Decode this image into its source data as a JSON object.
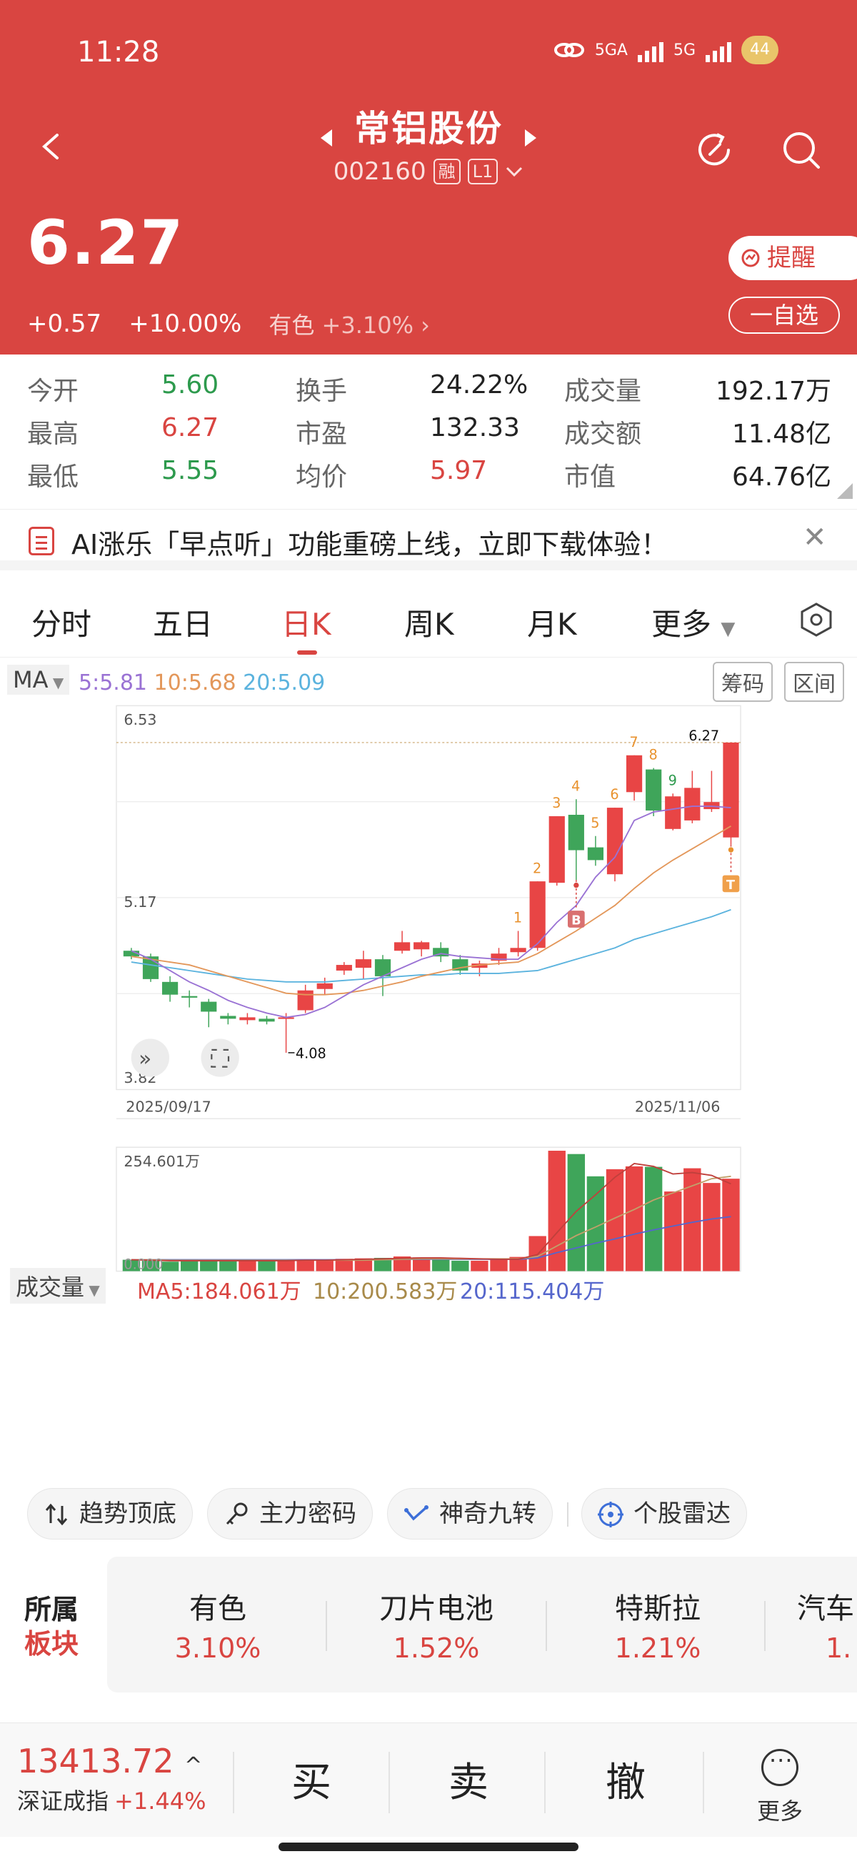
{
  "status_bar": {
    "time": "11:28",
    "net1": "5GA",
    "net2": "5G",
    "battery": "44"
  },
  "header": {
    "stock_name": "常铝股份",
    "stock_code": "002160",
    "tag_margin": "融",
    "tag_level": "L1",
    "price": "6.27",
    "change": "+0.57",
    "change_pct": "+10.00%",
    "sector_name": "有色",
    "sector_pct": "+3.10%",
    "remind_label": "提醒",
    "fav_label": "一自选"
  },
  "quote": {
    "open_label": "今开",
    "open": "5.60",
    "high_label": "最高",
    "high": "6.27",
    "low_label": "最低",
    "low": "5.55",
    "turnover_label": "换手",
    "turnover": "24.22%",
    "pe_label": "市盈",
    "pe": "132.33",
    "avg_label": "均价",
    "avg": "5.97",
    "volume_label": "成交量",
    "volume": "192.17万",
    "amount_label": "成交额",
    "amount": "11.48亿",
    "mktcap_label": "市值",
    "mktcap": "64.76亿"
  },
  "notice": {
    "text": "AI涨乐「早点听」功能重磅上线，立即下载体验！"
  },
  "tabs": [
    "分时",
    "五日",
    "日K",
    "周K",
    "月K",
    "更多"
  ],
  "ma": {
    "selector": "MA",
    "ma5": "5:5.81",
    "ma10": "10:5.68",
    "ma20": "20:5.09",
    "chip_label": "筹码",
    "range_label": "区间"
  },
  "volume_header": {
    "selector": "成交量",
    "ma5": "MA5:184.061万",
    "ma10": "10:200.583万",
    "ma20": "20:115.404万"
  },
  "tools": [
    "趋势顶底",
    "主力密码",
    "神奇九转",
    "个股雷达"
  ],
  "sectors": {
    "title1": "所属",
    "title2": "板块",
    "items": [
      {
        "name": "有色",
        "pct": "3.10%"
      },
      {
        "name": "刀片电池",
        "pct": "1.52%"
      },
      {
        "name": "特斯拉",
        "pct": "1.21%"
      },
      {
        "name": "汽车",
        "pct": "1."
      }
    ]
  },
  "bottom": {
    "index_value": "13413.72",
    "index_name": "深证成指",
    "index_pct": "+1.44%",
    "buy": "买",
    "sell": "卖",
    "cancel": "撤",
    "more": "更多"
  },
  "colors": {
    "up": "#e84545",
    "down": "#3fa55a",
    "brand": "#d94541",
    "ma5": "#9a72d4",
    "ma10": "#e3975a",
    "ma20": "#5bb3de"
  },
  "chart_data": {
    "type": "candlestick",
    "x_start": "2025/09/17",
    "x_end": "2025/11/06",
    "y_labels": [
      "6.53",
      "5.17",
      "3.82"
    ],
    "ylim": [
      3.82,
      6.53
    ],
    "max_label": "6.27",
    "min_label": "4.08",
    "candles": [
      {
        "o": 4.8,
        "c": 4.76,
        "h": 4.82,
        "l": 4.74
      },
      {
        "o": 4.76,
        "c": 4.6,
        "h": 4.78,
        "l": 4.58
      },
      {
        "o": 4.58,
        "c": 4.49,
        "h": 4.62,
        "l": 4.44
      },
      {
        "o": 4.48,
        "c": 4.47,
        "h": 4.52,
        "l": 4.4
      },
      {
        "o": 4.44,
        "c": 4.37,
        "h": 4.46,
        "l": 4.26
      },
      {
        "o": 4.34,
        "c": 4.32,
        "h": 4.36,
        "l": 4.28
      },
      {
        "o": 4.31,
        "c": 4.33,
        "h": 4.36,
        "l": 4.28
      },
      {
        "o": 4.32,
        "c": 4.3,
        "h": 4.34,
        "l": 4.28
      },
      {
        "o": 4.32,
        "c": 4.33,
        "h": 4.36,
        "l": 4.08
      },
      {
        "o": 4.38,
        "c": 4.52,
        "h": 4.56,
        "l": 4.36
      },
      {
        "o": 4.53,
        "c": 4.57,
        "h": 4.61,
        "l": 4.49
      },
      {
        "o": 4.66,
        "c": 4.7,
        "h": 4.72,
        "l": 4.63
      },
      {
        "o": 4.68,
        "c": 4.74,
        "h": 4.8,
        "l": 4.6
      },
      {
        "o": 4.74,
        "c": 4.62,
        "h": 4.77,
        "l": 4.48
      },
      {
        "o": 4.8,
        "c": 4.86,
        "h": 4.94,
        "l": 4.78
      },
      {
        "o": 4.81,
        "c": 4.86,
        "h": 4.87,
        "l": 4.76
      },
      {
        "o": 4.82,
        "c": 4.76,
        "h": 4.86,
        "l": 4.72
      },
      {
        "o": 4.74,
        "c": 4.66,
        "h": 4.77,
        "l": 4.63
      },
      {
        "o": 4.68,
        "c": 4.71,
        "h": 4.73,
        "l": 4.62
      },
      {
        "o": 4.73,
        "c": 4.78,
        "h": 4.82,
        "l": 4.7
      },
      {
        "o": 4.79,
        "c": 4.82,
        "h": 4.94,
        "l": 4.76
      },
      {
        "o": 4.82,
        "c": 5.29,
        "h": 5.29,
        "l": 4.8
      },
      {
        "o": 5.28,
        "c": 5.75,
        "h": 5.75,
        "l": 5.26
      },
      {
        "o": 5.76,
        "c": 5.51,
        "h": 5.87,
        "l": 5.3
      },
      {
        "o": 5.53,
        "c": 5.44,
        "h": 5.61,
        "l": 5.4
      },
      {
        "o": 5.34,
        "c": 5.81,
        "h": 5.81,
        "l": 5.29
      },
      {
        "o": 5.92,
        "c": 6.18,
        "h": 6.18,
        "l": 5.86
      },
      {
        "o": 6.08,
        "c": 5.79,
        "h": 6.09,
        "l": 5.75
      },
      {
        "o": 5.66,
        "c": 5.89,
        "h": 5.91,
        "l": 5.65
      },
      {
        "o": 5.72,
        "c": 5.95,
        "h": 6.07,
        "l": 5.7
      },
      {
        "o": 5.8,
        "c": 5.85,
        "h": 6.07,
        "l": 5.78
      },
      {
        "o": 5.6,
        "c": 6.27,
        "h": 6.27,
        "l": 5.55
      }
    ],
    "ma5": [
      4.8,
      4.74,
      4.66,
      4.58,
      4.52,
      4.45,
      4.4,
      4.36,
      4.33,
      4.35,
      4.4,
      4.48,
      4.56,
      4.62,
      4.68,
      4.74,
      4.78,
      4.76,
      4.75,
      4.74,
      4.74,
      4.85,
      5.0,
      5.12,
      5.32,
      5.46,
      5.72,
      5.78,
      5.8,
      5.82,
      5.82,
      5.81
    ],
    "ma10": [
      4.76,
      4.74,
      4.72,
      4.7,
      4.66,
      4.62,
      4.58,
      4.54,
      4.5,
      4.49,
      4.49,
      4.5,
      4.52,
      4.55,
      4.58,
      4.62,
      4.65,
      4.68,
      4.7,
      4.71,
      4.72,
      4.78,
      4.86,
      4.94,
      5.03,
      5.12,
      5.24,
      5.35,
      5.44,
      5.52,
      5.6,
      5.68
    ],
    "ma20": [
      4.72,
      4.7,
      4.68,
      4.66,
      4.64,
      4.62,
      4.6,
      4.59,
      4.58,
      4.58,
      4.58,
      4.59,
      4.6,
      4.61,
      4.62,
      4.63,
      4.63,
      4.64,
      4.64,
      4.64,
      4.65,
      4.66,
      4.7,
      4.74,
      4.78,
      4.82,
      4.88,
      4.92,
      4.96,
      5.0,
      5.04,
      5.09
    ],
    "nine_turn": [
      {
        "i": 20,
        "label": "1"
      },
      {
        "i": 21,
        "label": "2"
      },
      {
        "i": 22,
        "label": "3"
      },
      {
        "i": 23,
        "label": "4"
      },
      {
        "i": 24,
        "label": "5"
      },
      {
        "i": 25,
        "label": "6"
      },
      {
        "i": 26,
        "label": "7"
      },
      {
        "i": 27,
        "label": "8"
      },
      {
        "i": 28,
        "label": "9"
      }
    ],
    "markers": [
      {
        "i": 23,
        "label": "B"
      },
      {
        "i": 31,
        "label": "T"
      }
    ],
    "volume": {
      "max_label": "254.601万",
      "zero_label": "0.000",
      "values": [
        24,
        22,
        20,
        21,
        22,
        21,
        22,
        22,
        23,
        25,
        24,
        26,
        27,
        28,
        31,
        29,
        26,
        22,
        22,
        25,
        30,
        74,
        254,
        247,
        200,
        215,
        221,
        220,
        168,
        217,
        186,
        195
      ],
      "ma5": [
        24,
        23,
        22,
        22,
        22,
        22,
        22,
        22,
        22,
        23,
        23,
        24,
        25,
        26,
        27,
        28,
        28,
        27,
        26,
        25,
        25,
        35,
        81,
        126,
        161,
        198,
        227,
        221,
        205,
        208,
        202,
        184
      ],
      "ma10": [
        24,
        24,
        23,
        23,
        23,
        23,
        23,
        23,
        23,
        23,
        23,
        23,
        23,
        24,
        25,
        26,
        26,
        26,
        26,
        26,
        26,
        31,
        53,
        75,
        93,
        112,
        130,
        150,
        165,
        180,
        195,
        200
      ],
      "ma20": [
        24,
        24,
        24,
        24,
        24,
        24,
        24,
        24,
        24,
        24,
        24,
        24,
        24,
        24,
        25,
        25,
        25,
        25,
        25,
        25,
        25,
        28,
        39,
        49,
        59,
        68,
        78,
        87,
        95,
        103,
        110,
        115
      ]
    }
  }
}
